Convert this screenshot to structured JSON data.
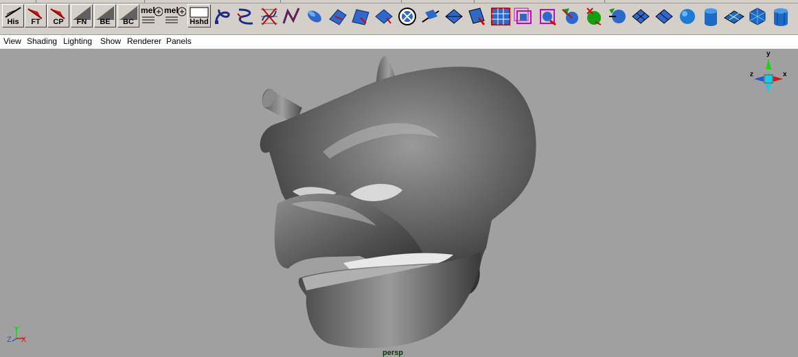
{
  "shelf": {
    "buttons": [
      {
        "label": "His",
        "icon": "history-icon"
      },
      {
        "label": "FT",
        "icon": "freeze-transform-icon"
      },
      {
        "label": "CP",
        "icon": "center-pivot-icon"
      },
      {
        "label": "FN",
        "icon": "freeze-normals-icon"
      },
      {
        "label": "BE",
        "icon": "bevel-edge-icon"
      },
      {
        "label": "BC",
        "icon": "bridge-component-icon"
      },
      {
        "label": "mel",
        "icon": "mel-script-icon"
      },
      {
        "label": "mel",
        "icon": "mel-script-icon"
      },
      {
        "label": "Hshd",
        "icon": "hardware-shade-icon"
      }
    ],
    "tool_icons": [
      "cv-curve-icon",
      "ep-curve-icon",
      "pencil-curve-icon",
      "arc-tool-icon",
      "revolve-icon",
      "loft-icon",
      "planar-icon",
      "extrude-icon",
      "circle-fillet-icon",
      "project-curve-icon",
      "trim-tool-icon",
      "insert-isoparm-icon",
      "attach-surface-icon",
      "sculpt-surface-icon",
      "lattice-icon",
      "cluster-icon",
      "sphere-split-icon",
      "sphere-green-icon",
      "sphere-cut-icon",
      "poly-plane-icon",
      "poly-grid-icon",
      "poly-sphere-icon",
      "poly-cylinder-icon",
      "poly-plane-flat-icon",
      "poly-soccerball-icon",
      "poly-cylinder-tall-icon"
    ]
  },
  "menu": [
    "View",
    "Shading",
    "Lighting",
    "Show",
    "Renderer",
    "Panels"
  ],
  "viewport": {
    "camera": "persp",
    "view_axes": {
      "y": "y",
      "z": "z",
      "x": "x"
    },
    "origin_axes": {
      "y": "Y",
      "z": "Z",
      "x": "X"
    }
  },
  "colors": {
    "viewport_bg": "#a0a0a0",
    "axis_x": "#d81414",
    "axis_y": "#14d814",
    "axis_z": "#1c5ae0",
    "camera_label": "#0a3a0a"
  }
}
